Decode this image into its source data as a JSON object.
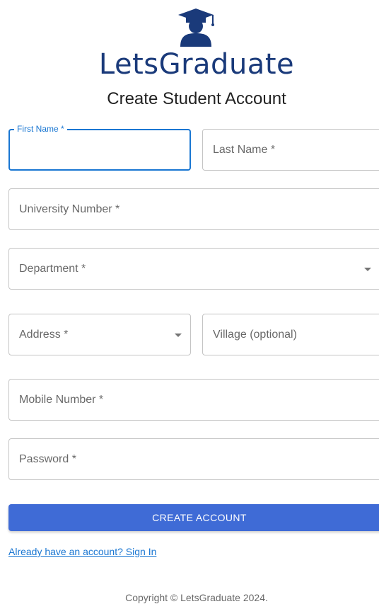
{
  "brand": {
    "name": "LetsGraduate",
    "logo_icon": "graduate-cap-person-icon",
    "color": "#1a3a7a"
  },
  "page_title": "Create Student Account",
  "form": {
    "first_name": {
      "label": "First Name *",
      "value": "",
      "focused": true
    },
    "last_name": {
      "label": "Last Name *",
      "value": ""
    },
    "university_number": {
      "label": "University Number *",
      "value": ""
    },
    "department": {
      "label": "Department *",
      "value": ""
    },
    "address": {
      "label": "Address *",
      "value": ""
    },
    "village": {
      "label": "Village (optional)",
      "value": ""
    },
    "mobile_number": {
      "label": "Mobile Number *",
      "value": ""
    },
    "password": {
      "label": "Password *",
      "value": ""
    }
  },
  "submit_label": "CREATE ACCOUNT",
  "signin_link": "Already have an account? Sign In",
  "copyright": "Copyright © LetsGraduate 2024.",
  "colors": {
    "primary": "#1976d2",
    "button": "#3f6bd6",
    "border": "#c4c4c4"
  }
}
